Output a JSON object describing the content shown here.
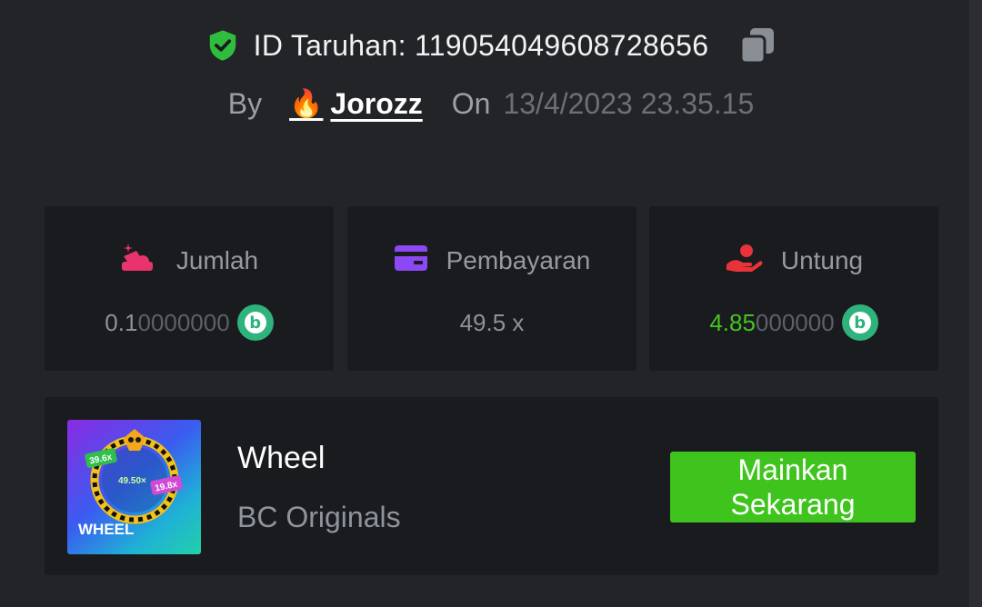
{
  "header": {
    "bet_id_label": "ID Taruhan: 119054049608728656",
    "by_label": "By",
    "username": "Jorozz",
    "on_label": "On",
    "datetime": "13/4/2023 23.35.15"
  },
  "stats": {
    "amount": {
      "label": "Jumlah",
      "value_main": "0.1",
      "value_dim": "0000000",
      "icon": "coins-icon"
    },
    "payout": {
      "label": "Pembayaran",
      "value": "49.5 x",
      "icon": "wallet-card-icon"
    },
    "profit": {
      "label": "Untung",
      "value_main": "4.85",
      "value_dim": "000000",
      "icon": "hand-profit-icon"
    },
    "currency_glyph": "b"
  },
  "game": {
    "title": "Wheel",
    "provider": "BC Originals",
    "play_button": "Mainkan\nSekarang",
    "thumb_label": "WHEEL",
    "thumb_multipliers": [
      "39.6x",
      "49.50×",
      "19.8x"
    ]
  },
  "colors": {
    "background": "#232427",
    "card": "#1a1b1e",
    "accent_green": "#3fc41d",
    "profit_green": "#43c421",
    "coin": "#2db37b"
  }
}
